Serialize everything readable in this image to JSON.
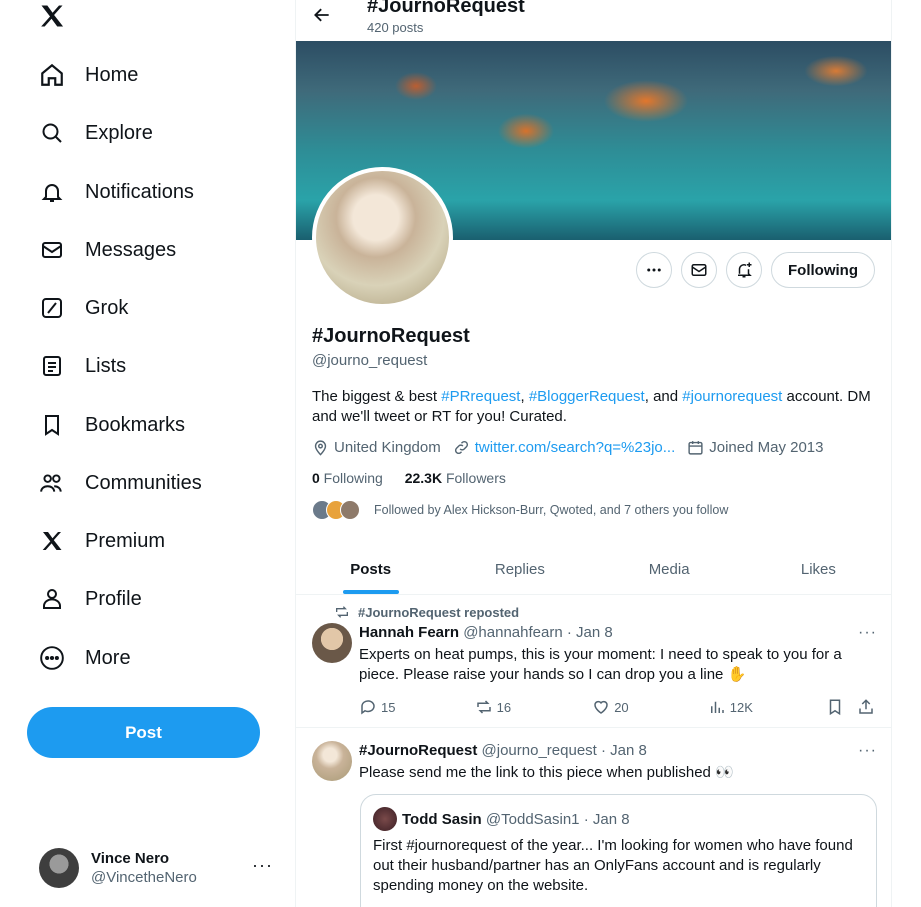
{
  "nav": {
    "items": [
      {
        "label": "Home",
        "icon": "home-icon"
      },
      {
        "label": "Explore",
        "icon": "search-icon"
      },
      {
        "label": "Notifications",
        "icon": "bell-icon"
      },
      {
        "label": "Messages",
        "icon": "envelope-icon"
      },
      {
        "label": "Grok",
        "icon": "grok-icon"
      },
      {
        "label": "Lists",
        "icon": "list-icon"
      },
      {
        "label": "Bookmarks",
        "icon": "bookmark-icon"
      },
      {
        "label": "Communities",
        "icon": "communities-icon"
      },
      {
        "label": "Premium",
        "icon": "x-logo-icon"
      },
      {
        "label": "Profile",
        "icon": "person-icon"
      },
      {
        "label": "More",
        "icon": "more-circle-icon"
      }
    ],
    "post_label": "Post"
  },
  "account": {
    "name": "Vince Nero",
    "handle": "@VincetheNero",
    "more": "···"
  },
  "header": {
    "title": "#JournoRequest",
    "subtitle": "420 posts"
  },
  "profile": {
    "name": "#JournoRequest",
    "handle": "@journo_request",
    "bio": {
      "part1": "The biggest & best ",
      "link1": "#PRrequest",
      "part2": ", ",
      "link2": "#BloggerRequest",
      "part3": ", and ",
      "link3": "#journorequest",
      "part4": " account. DM and we'll tweet or RT for you! Curated."
    },
    "location": "United Kingdom",
    "website": "twitter.com/search?q=%23jo...",
    "joined": "Joined May 2013",
    "following_count": "0",
    "following_label": " Following",
    "followers_count": "22.3K",
    "followers_label": " Followers",
    "followed_by": "Followed by Alex Hickson-Burr, Qwoted, and 7 others you follow",
    "follow_button": "Following"
  },
  "tabs": [
    "Posts",
    "Replies",
    "Media",
    "Likes"
  ],
  "tweets": [
    {
      "repost_label": "#JournoRequest reposted",
      "name": "Hannah Fearn",
      "handle_time": "@hannahfearn · Jan 8",
      "text": "Experts on heat pumps, this is your moment: I need to speak to you for a piece. Please raise your hands so I can drop you a line ✋",
      "replies": "15",
      "reposts": "16",
      "likes": "20",
      "views": "12K",
      "more": "···"
    },
    {
      "name": "#JournoRequest",
      "handle_time": "@journo_request · Jan 8",
      "text": "Please send me the link to this piece when published 👀",
      "more": "···",
      "quote": {
        "name": "Todd Sasin",
        "handle_time": "@ToddSasin1 · Jan 8",
        "text": "First #journorequest of the year... I'm looking for women who have found out their husband/partner has an OnlyFans account and is regularly spending money on the website."
      }
    }
  ]
}
